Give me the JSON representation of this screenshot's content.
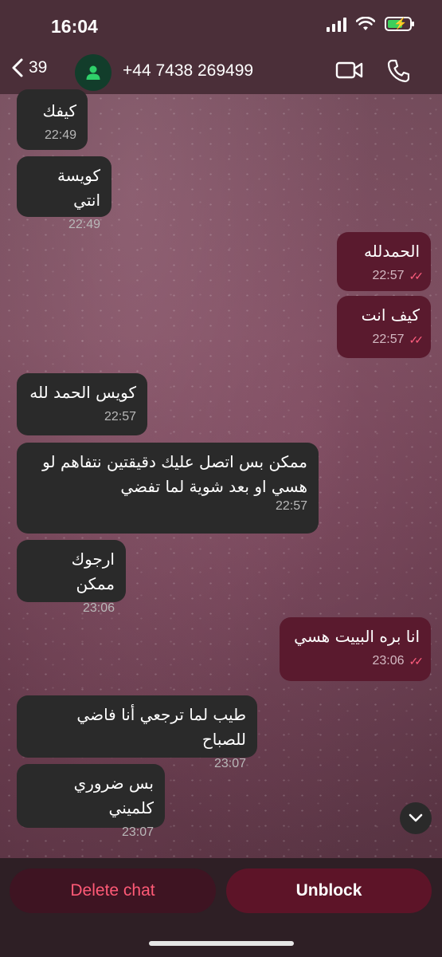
{
  "status_bar": {
    "time": "16:04"
  },
  "header": {
    "back_count": "39",
    "contact_name": "+44 7438 269499"
  },
  "messages": [
    {
      "text": "كيفك",
      "time": "22:49",
      "dir": "in"
    },
    {
      "text": "كويسة انتي",
      "time": "22:49",
      "dir": "in"
    },
    {
      "text": "الحمدلله",
      "time": "22:57",
      "dir": "out"
    },
    {
      "text": "كيف انت",
      "time": "22:57",
      "dir": "out"
    },
    {
      "text": "كويس الحمد لله",
      "time": "22:57",
      "dir": "in"
    },
    {
      "text": "ممكن بس اتصل عليك دقيقتين نتفاهم لو هسي او بعد شوية لما تفضي",
      "time": "22:57",
      "dir": "in"
    },
    {
      "text": "ارجوك ممكن",
      "time": "23:06",
      "dir": "in"
    },
    {
      "text": "انا بره البييت هسي",
      "time": "23:06",
      "dir": "out"
    },
    {
      "text": "طيب لما ترجعي أنا فاضي للصباح",
      "time": "23:07",
      "dir": "in"
    },
    {
      "text": "بس ضروري كلميني",
      "time": "23:07",
      "dir": "in"
    }
  ],
  "actions": {
    "delete_label": "Delete chat",
    "unblock_label": "Unblock"
  },
  "colors": {
    "incoming_bubble": "#2a2a2a",
    "outgoing_bubble": "#5a1a2e",
    "read_tick": "#ff5e7e",
    "delete_text": "#ff5a76"
  }
}
